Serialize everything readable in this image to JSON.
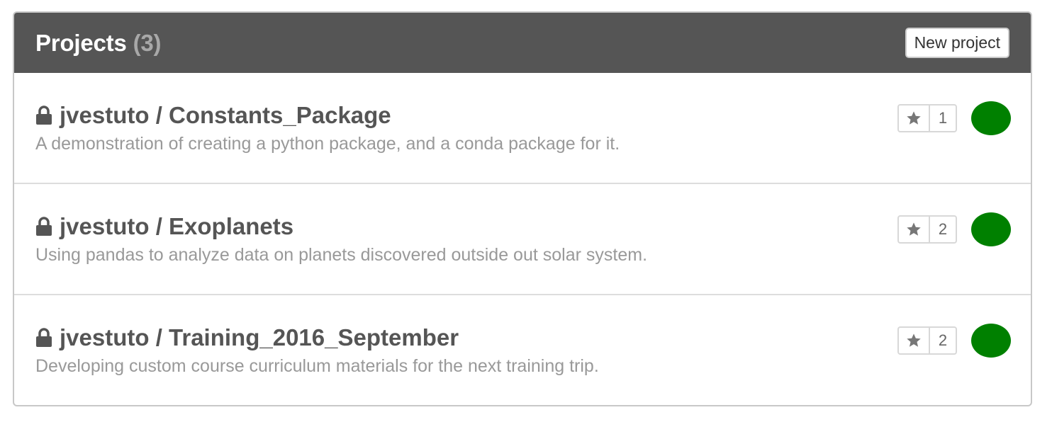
{
  "panel": {
    "title": "Projects",
    "count": "(3)",
    "new_project_label": "New project"
  },
  "colors": {
    "header_bg": "#555555",
    "status_green": "#008000",
    "description": "#999999"
  },
  "projects": [
    {
      "owner_repo": "jvestuto / Constants_Package",
      "description": "A demonstration of creating a python package, and a conda package for it.",
      "stars": "1",
      "icons": [
        "lock-icon",
        "star-icon",
        "status-dot"
      ]
    },
    {
      "owner_repo": "jvestuto / Exoplanets",
      "description": "Using pandas to analyze data on planets discovered outside out solar system.",
      "stars": "2",
      "icons": [
        "lock-icon",
        "star-icon",
        "status-dot"
      ]
    },
    {
      "owner_repo": "jvestuto / Training_2016_September",
      "description": "Developing custom course curriculum materials for the next training trip.",
      "stars": "2",
      "icons": [
        "lock-icon",
        "star-icon",
        "status-dot"
      ]
    }
  ]
}
